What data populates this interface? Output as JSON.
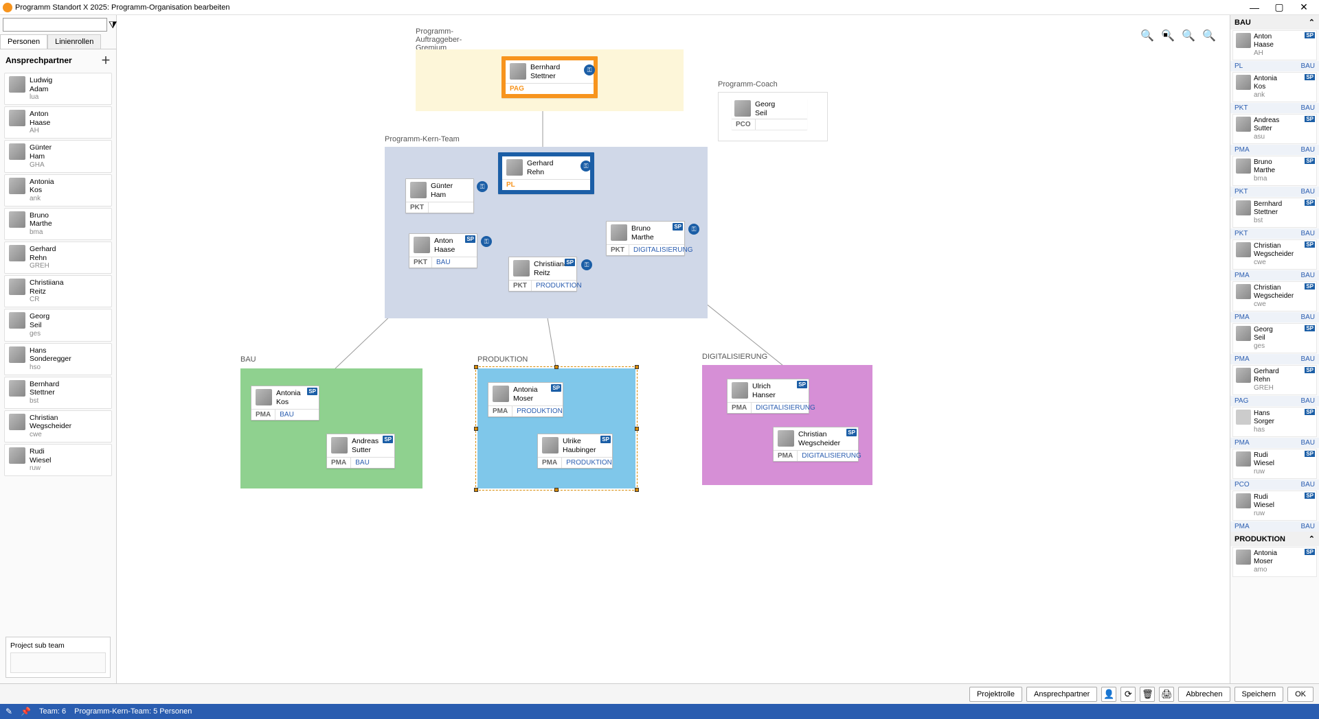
{
  "window": {
    "title": "Programm Standort X 2025: Programm-Organisation bearbeiten"
  },
  "left": {
    "tabs": [
      "Personen",
      "Linienrollen"
    ],
    "section": "Ansprechpartner",
    "persons": [
      {
        "first": "Ludwig",
        "last": "Adam",
        "code": "lua"
      },
      {
        "first": "Anton",
        "last": "Haase",
        "code": "AH"
      },
      {
        "first": "Günter",
        "last": "Ham",
        "code": "GHA"
      },
      {
        "first": "Antonia",
        "last": "Kos",
        "code": "ank"
      },
      {
        "first": "Bruno",
        "last": "Marthe",
        "code": "bma"
      },
      {
        "first": "Gerhard",
        "last": "Rehn",
        "code": "GREH"
      },
      {
        "first": "Christiiana",
        "last": "Reitz",
        "code": "CR"
      },
      {
        "first": "Georg",
        "last": "Seil",
        "code": "ges"
      },
      {
        "first": "Hans",
        "last": "Sonderegger",
        "code": "hso"
      },
      {
        "first": "Bernhard",
        "last": "Stettner",
        "code": "bst"
      },
      {
        "first": "Christian",
        "last": "Wegscheider",
        "code": "cwe"
      },
      {
        "first": "Rudi",
        "last": "Wiesel",
        "code": "ruw"
      }
    ],
    "subteam_label": "Project sub team"
  },
  "canvas": {
    "zones": {
      "auftraggeber": "Programm-Auftraggeber-Gremium",
      "kern": "Programm-Kern-Team",
      "coach": "Programm-Coach",
      "bau": "BAU",
      "produktion": "PRODUKTION",
      "digital": "DIGITALISIERUNG"
    },
    "cards": {
      "stettner": {
        "first": "Bernhard",
        "last": "Stettner",
        "role": "PAG"
      },
      "rehn": {
        "first": "Gerhard",
        "last": "Rehn",
        "role": "PL"
      },
      "ham": {
        "first": "Günter",
        "last": "Ham",
        "role": "PKT"
      },
      "haase": {
        "first": "Anton",
        "last": "Haase",
        "role": "PKT",
        "dept": "BAU"
      },
      "reitz": {
        "first": "Christiiana",
        "last": "Reitz",
        "role": "PKT",
        "dept": "PRODUKTION"
      },
      "marthe": {
        "first": "Bruno",
        "last": "Marthe",
        "role": "PKT",
        "dept": "DIGITALISIERUNG"
      },
      "seil": {
        "first": "Georg",
        "last": "Seil",
        "role": "PCO"
      },
      "kos": {
        "first": "Antonia",
        "last": "Kos",
        "role": "PMA",
        "dept": "BAU"
      },
      "sutter": {
        "first": "Andreas",
        "last": "Sutter",
        "role": "PMA",
        "dept": "BAU"
      },
      "moser": {
        "first": "Antonia",
        "last": "Moser",
        "role": "PMA",
        "dept": "PRODUKTION"
      },
      "haubinger": {
        "first": "Ulrike",
        "last": "Haubinger",
        "role": "PMA",
        "dept": "PRODUKTION"
      },
      "hanser": {
        "first": "Ulrich",
        "last": "Hanser",
        "role": "PMA",
        "dept": "DIGITALISIERUNG"
      },
      "wegscheider": {
        "first": "Christian",
        "last": "Wegscheider",
        "role": "PMA",
        "dept": "DIGITALISIERUNG"
      }
    }
  },
  "right": {
    "groups": [
      {
        "name": "BAU",
        "items": [
          {
            "first": "Anton",
            "last": "Haase",
            "code": "AH",
            "role": "PL",
            "dept": "BAU",
            "sp": true
          },
          {
            "first": "Antonia",
            "last": "Kos",
            "code": "ank",
            "role": "PKT",
            "dept": "BAU",
            "sp": true
          },
          {
            "first": "Andreas",
            "last": "Sutter",
            "code": "asu",
            "role": "PMA",
            "dept": "BAU",
            "sp": true
          },
          {
            "first": "Bruno",
            "last": "Marthe",
            "code": "bma",
            "role": "PKT",
            "dept": "BAU",
            "sp": true
          },
          {
            "first": "Bernhard",
            "last": "Stettner",
            "code": "bst",
            "role": "PKT",
            "dept": "BAU",
            "sp": true
          },
          {
            "first": "Christian",
            "last": "Wegscheider",
            "code": "cwe",
            "role": "PMA",
            "dept": "BAU",
            "sp": true
          },
          {
            "first": "Christian",
            "last": "Wegscheider",
            "code": "cwe",
            "role": "PMA",
            "dept": "BAU",
            "sp": true
          },
          {
            "first": "Georg",
            "last": "Seil",
            "code": "ges",
            "role": "PMA",
            "dept": "BAU",
            "sp": true
          },
          {
            "first": "Gerhard",
            "last": "Rehn",
            "code": "GREH",
            "role": "PAG",
            "dept": "BAU",
            "sp": true
          },
          {
            "first": "Hans",
            "last": "Sorger",
            "code": "has",
            "role": "PMA",
            "dept": "BAU",
            "sp": true,
            "gray": true
          },
          {
            "first": "Rudi",
            "last": "Wiesel",
            "code": "ruw",
            "role": "PCO",
            "dept": "BAU",
            "sp": true
          },
          {
            "first": "Rudi",
            "last": "Wiesel",
            "code": "ruw",
            "role": "PMA",
            "dept": "BAU",
            "sp": true
          }
        ]
      },
      {
        "name": "PRODUKTION",
        "items": [
          {
            "first": "Antonia",
            "last": "Moser",
            "code": "amo",
            "role": "",
            "dept": "",
            "sp": true
          }
        ]
      }
    ]
  },
  "bottom": {
    "buttons": [
      "Projektrolle",
      "Ansprechpartner"
    ],
    "actions": [
      "Abbrechen",
      "Speichern",
      "OK"
    ]
  },
  "status": {
    "team_count": "Team: 6",
    "team_detail": "Programm-Kern-Team: 5 Personen"
  }
}
